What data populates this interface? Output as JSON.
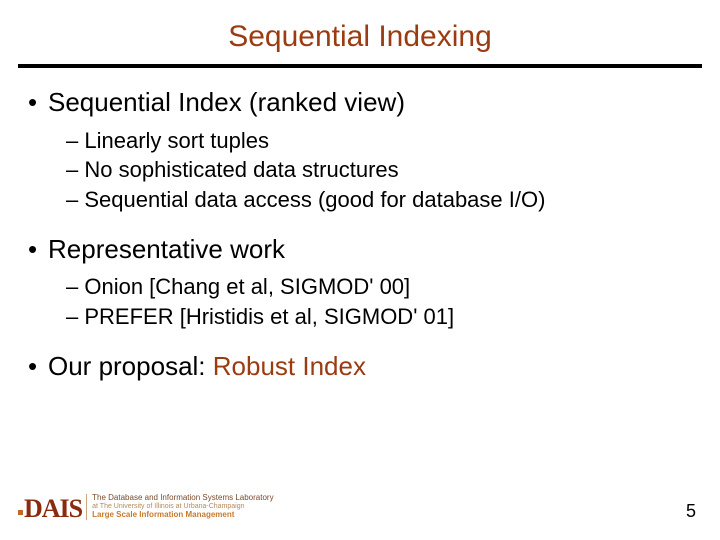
{
  "title": "Sequential Indexing",
  "bullets": [
    {
      "text": "Sequential Index (ranked view)",
      "sub": [
        "Linearly sort tuples",
        "No sophisticated data structures",
        "Sequential data access (good for database I/O)"
      ]
    },
    {
      "text": "Representative work",
      "sub": [
        "Onion [Chang et al, SIGMOD' 00]",
        "PREFER [Hristidis et al, SIGMOD' 01]"
      ]
    },
    {
      "text": "Our proposal: ",
      "highlight": "Robust Index",
      "sub": []
    }
  ],
  "logo": {
    "mark": "DAIS",
    "line1": "The Database and Information Systems Laboratory",
    "line2": "at The University of Illinois at Urbana-Champaign",
    "line3": "Large Scale Information Management"
  },
  "page_number": "5"
}
